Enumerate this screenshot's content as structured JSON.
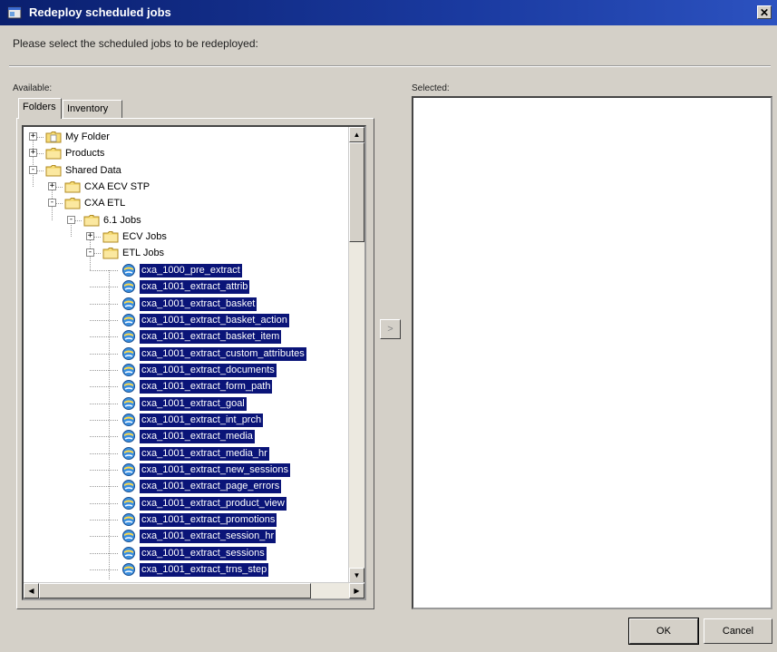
{
  "window": {
    "title": "Redeploy scheduled jobs",
    "close_glyph": "✕"
  },
  "instruction": "Please select the scheduled jobs to be redeployed:",
  "available_label": "Available:",
  "selected_label": "Selected:",
  "tabs": [
    {
      "label": "Folders",
      "active": true
    },
    {
      "label": "Inventory",
      "active": false
    }
  ],
  "tree": [
    {
      "label": "My Folder",
      "type": "folder",
      "depth": 0,
      "expander": "+"
    },
    {
      "label": "Products",
      "type": "folder",
      "depth": 0,
      "expander": "+"
    },
    {
      "label": "Shared Data",
      "type": "folder",
      "depth": 0,
      "expander": "-"
    },
    {
      "label": "CXA ECV STP",
      "type": "folder",
      "depth": 1,
      "expander": "+"
    },
    {
      "label": "CXA ETL",
      "type": "folder",
      "depth": 1,
      "expander": "-"
    },
    {
      "label": "6.1 Jobs",
      "type": "folder",
      "depth": 2,
      "expander": "-"
    },
    {
      "label": "ECV Jobs",
      "type": "folder",
      "depth": 3,
      "expander": "+"
    },
    {
      "label": "ETL Jobs",
      "type": "folder",
      "depth": 3,
      "expander": "-"
    },
    {
      "label": "cxa_1000_pre_extract",
      "type": "job",
      "depth": 4,
      "selected": true
    },
    {
      "label": "cxa_1001_extract_attrib",
      "type": "job",
      "depth": 4,
      "selected": true
    },
    {
      "label": "cxa_1001_extract_basket",
      "type": "job",
      "depth": 4,
      "selected": true
    },
    {
      "label": "cxa_1001_extract_basket_action",
      "type": "job",
      "depth": 4,
      "selected": true
    },
    {
      "label": "cxa_1001_extract_basket_item",
      "type": "job",
      "depth": 4,
      "selected": true
    },
    {
      "label": "cxa_1001_extract_custom_attributes",
      "type": "job",
      "depth": 4,
      "selected": true
    },
    {
      "label": "cxa_1001_extract_documents",
      "type": "job",
      "depth": 4,
      "selected": true
    },
    {
      "label": "cxa_1001_extract_form_path",
      "type": "job",
      "depth": 4,
      "selected": true
    },
    {
      "label": "cxa_1001_extract_goal",
      "type": "job",
      "depth": 4,
      "selected": true
    },
    {
      "label": "cxa_1001_extract_int_prch",
      "type": "job",
      "depth": 4,
      "selected": true
    },
    {
      "label": "cxa_1001_extract_media",
      "type": "job",
      "depth": 4,
      "selected": true
    },
    {
      "label": "cxa_1001_extract_media_hr",
      "type": "job",
      "depth": 4,
      "selected": true
    },
    {
      "label": "cxa_1001_extract_new_sessions",
      "type": "job",
      "depth": 4,
      "selected": true
    },
    {
      "label": "cxa_1001_extract_page_errors",
      "type": "job",
      "depth": 4,
      "selected": true
    },
    {
      "label": "cxa_1001_extract_product_view",
      "type": "job",
      "depth": 4,
      "selected": true
    },
    {
      "label": "cxa_1001_extract_promotions",
      "type": "job",
      "depth": 4,
      "selected": true
    },
    {
      "label": "cxa_1001_extract_session_hr",
      "type": "job",
      "depth": 4,
      "selected": true
    },
    {
      "label": "cxa_1001_extract_sessions",
      "type": "job",
      "depth": 4,
      "selected": true
    },
    {
      "label": "cxa_1001_extract_trns_step",
      "type": "job",
      "depth": 4,
      "selected": true
    }
  ],
  "move_button_glyph": ">",
  "buttons": {
    "ok": "OK",
    "cancel": "Cancel"
  }
}
